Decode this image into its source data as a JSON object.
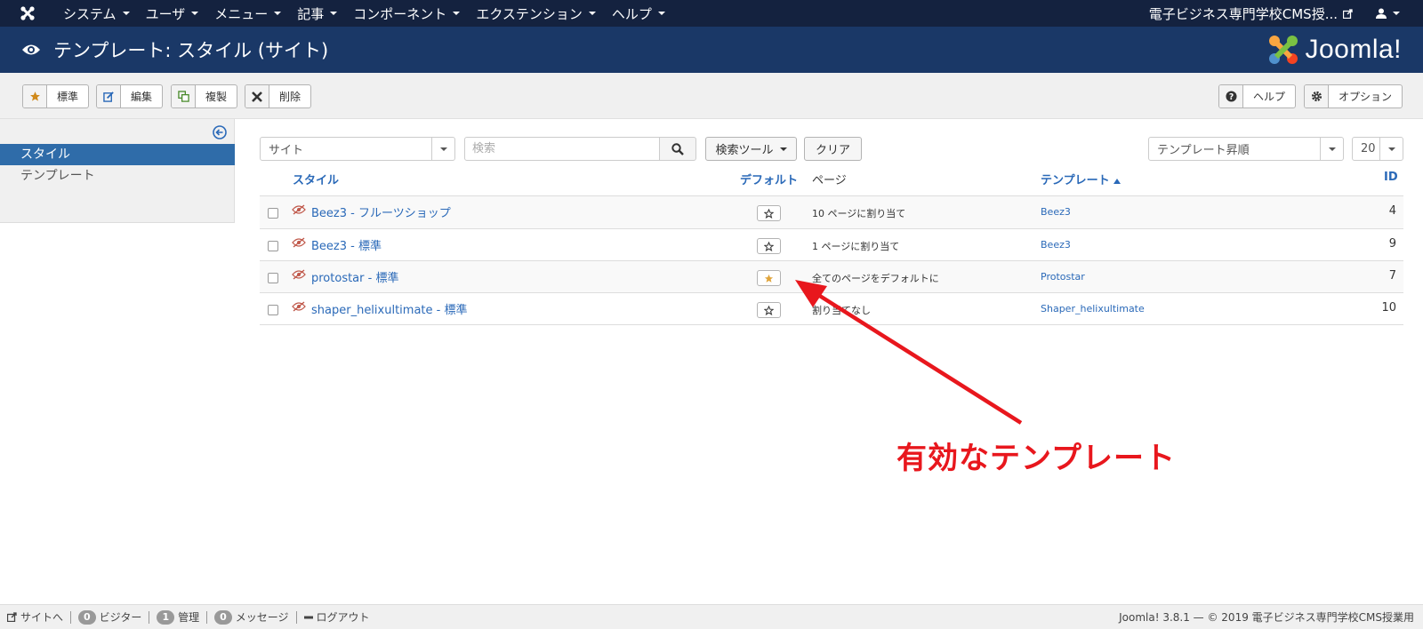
{
  "navbar": {
    "menu": [
      "システム",
      "ユーザ",
      "メニュー",
      "記事",
      "コンポーネント",
      "エクステンション",
      "ヘルプ"
    ],
    "site_name": "電子ビジネス専門学校CMS授..."
  },
  "header": {
    "title": "テンプレート: スタイル (サイト)",
    "brand": "Joomla!"
  },
  "toolbar": {
    "default_label": "標準",
    "edit_label": "編集",
    "duplicate_label": "複製",
    "delete_label": "削除",
    "help_label": "ヘルプ",
    "options_label": "オプション"
  },
  "sidebar": {
    "items": [
      {
        "label": "スタイル",
        "active": true
      },
      {
        "label": "テンプレート",
        "active": false
      }
    ]
  },
  "filters": {
    "client": "サイト",
    "search_placeholder": "検索",
    "search_tools_label": "検索ツール",
    "clear_label": "クリア",
    "ordering": "テンプレート昇順",
    "limit": "20"
  },
  "table": {
    "headers": {
      "style": "スタイル",
      "default": "デフォルト",
      "pages": "ページ",
      "template": "テンプレート",
      "id": "ID"
    },
    "rows": [
      {
        "style": "Beez3 - フルーツショップ",
        "default": false,
        "pages": "10 ページに割り当て",
        "template": "Beez3",
        "id": "4"
      },
      {
        "style": "Beez3 - 標準",
        "default": false,
        "pages": "1 ページに割り当て",
        "template": "Beez3",
        "id": "9"
      },
      {
        "style": "protostar - 標準",
        "default": true,
        "pages": "全てのページをデフォルトに",
        "template": "Protostar",
        "id": "7"
      },
      {
        "style": "shaper_helixultimate - 標準",
        "default": false,
        "pages": "割り当てなし",
        "template": "Shaper_helixultimate",
        "id": "10"
      }
    ]
  },
  "annotation": {
    "text": "有効なテンプレート",
    "color": "#e8171d"
  },
  "footer": {
    "view_site": "サイトへ",
    "visitors_count": "0",
    "visitors_label": "ビジター",
    "admins_count": "1",
    "admins_label": "管理",
    "messages_count": "0",
    "messages_label": "メッセージ",
    "logout": "ログアウト",
    "copyright": "Joomla! 3.8.1 — © 2019 電子ビジネス専門学校CMS授業用"
  },
  "colors": {
    "navbar_bg": "#14223f",
    "header_bg": "#1a3867",
    "accent": "#2f6ca9",
    "link": "#2a69b8",
    "star_active": "#e0a43a"
  }
}
